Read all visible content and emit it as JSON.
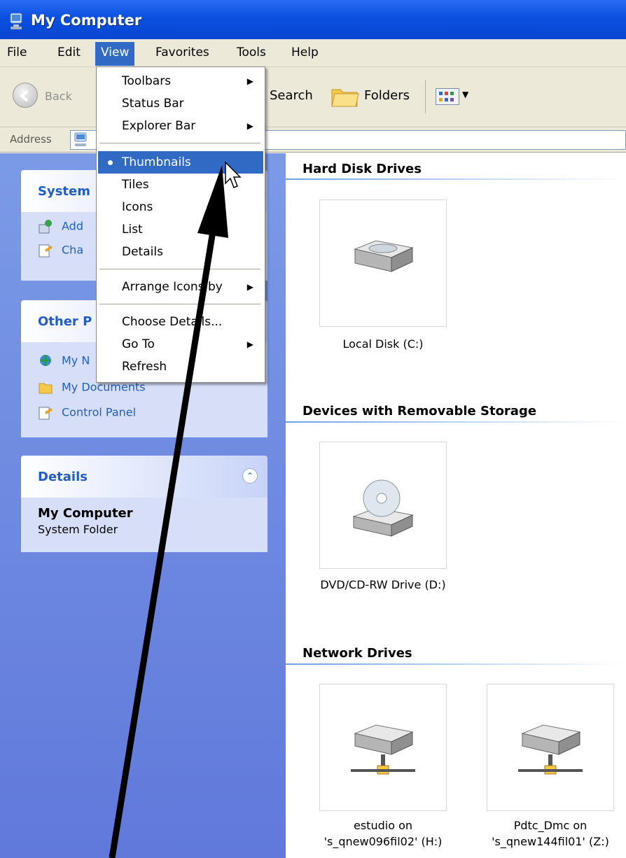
{
  "window": {
    "title": "My Computer",
    "icon": "computer-icon"
  },
  "menubar": {
    "items": [
      "File",
      "Edit",
      "View",
      "Favorites",
      "Tools",
      "Help"
    ],
    "active": "View"
  },
  "toolbar": {
    "back_label": "Back",
    "search_label": "Search",
    "folders_label": "Folders",
    "views_icon": "views-icon"
  },
  "address": {
    "label": "Address"
  },
  "view_menu": {
    "items": [
      {
        "label": "Toolbars",
        "submenu": true
      },
      {
        "label": "Status Bar"
      },
      {
        "label": "Explorer Bar",
        "submenu": true
      },
      {
        "label": "Thumbnails",
        "selected": true
      },
      {
        "label": "Tiles"
      },
      {
        "label": "Icons"
      },
      {
        "label": "List"
      },
      {
        "label": "Details"
      },
      {
        "label": "Arrange Icons by",
        "submenu": true
      },
      {
        "label": "Choose Details..."
      },
      {
        "label": "Go To",
        "submenu": true
      },
      {
        "label": "Refresh"
      }
    ]
  },
  "left_pane": {
    "system_tasks": {
      "title": "System",
      "links": [
        "Add",
        "Cha"
      ]
    },
    "other_places": {
      "title": "Other P",
      "links": [
        "My N",
        "My Documents",
        "Control Panel"
      ]
    },
    "details": {
      "title": "Details",
      "name": "My Computer",
      "type": "System Folder"
    }
  },
  "groups": {
    "hard_disk": {
      "title": "Hard Disk Drives",
      "items": [
        {
          "line1": "Local Disk (C:)",
          "line2": ""
        }
      ]
    },
    "removable": {
      "title": "Devices with Removable Storage",
      "items": [
        {
          "line1": "DVD/CD-RW Drive (D:)",
          "line2": ""
        }
      ]
    },
    "network": {
      "title": "Network Drives",
      "items": [
        {
          "line1": "estudio on",
          "line2": "'s_qnew096fil02' (H:)"
        },
        {
          "line1": "Pdtc_Dmc on",
          "line2": "'s_qnew144fil01' (Z:)"
        }
      ]
    }
  },
  "colors": {
    "titlebar": "#0b4fe0",
    "menu_highlight": "#316ac5",
    "task_pane": "#6d8ae0",
    "link": "#215dc6"
  }
}
